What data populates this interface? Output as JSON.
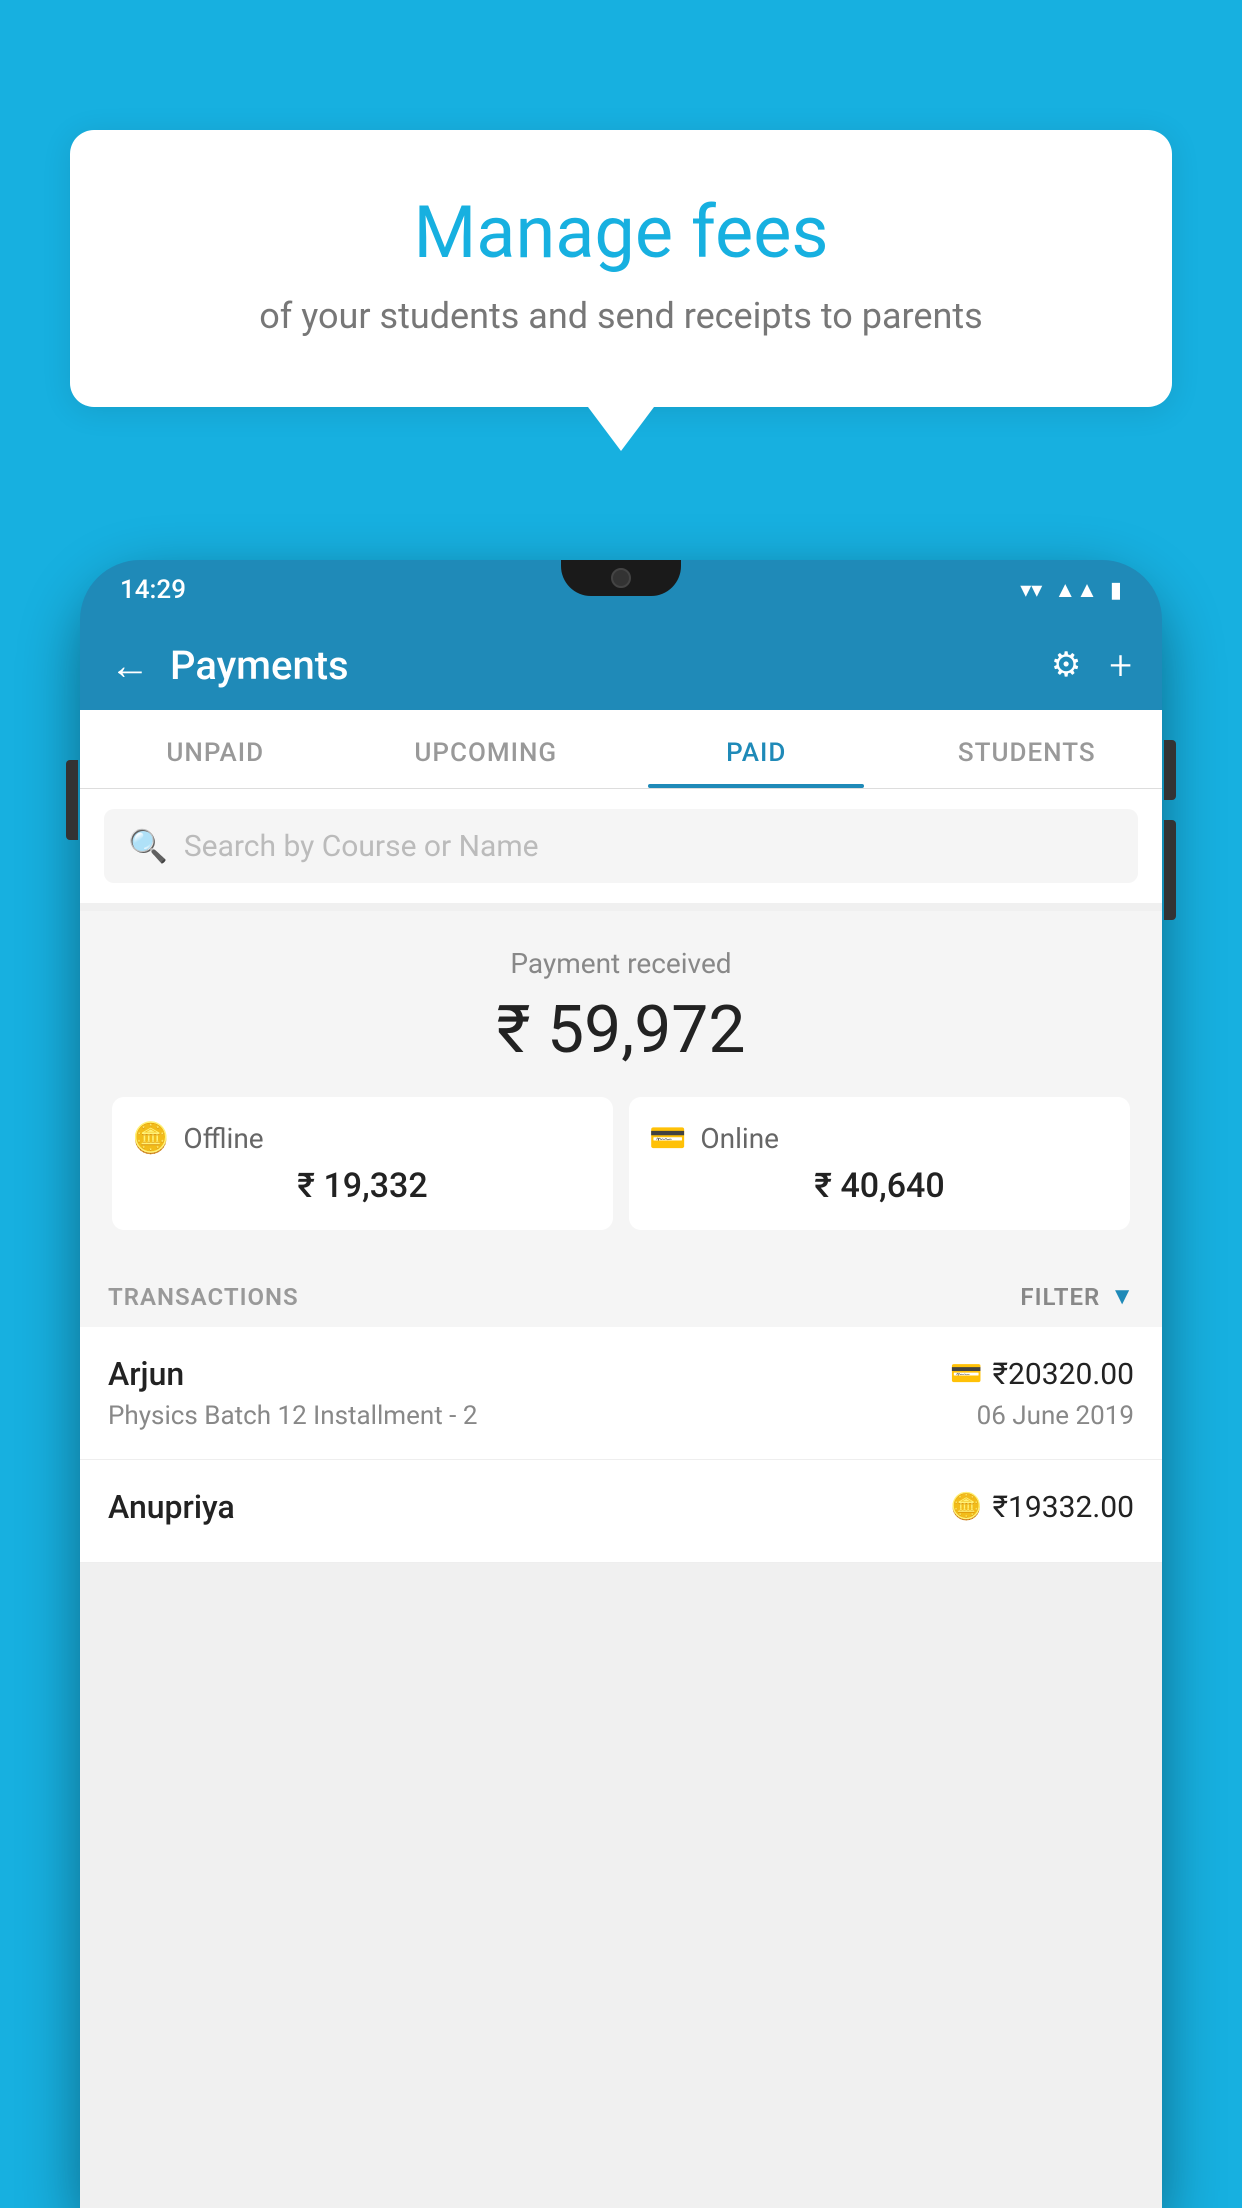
{
  "background_color": "#17B0E0",
  "speech_bubble": {
    "title": "Manage fees",
    "subtitle": "of your students and send receipts to parents"
  },
  "status_bar": {
    "time": "14:29",
    "icons": [
      "wifi",
      "signal",
      "battery"
    ]
  },
  "header": {
    "title": "Payments",
    "back_label": "←",
    "gear_label": "⚙",
    "plus_label": "+"
  },
  "tabs": [
    {
      "label": "UNPAID",
      "active": false
    },
    {
      "label": "UPCOMING",
      "active": false
    },
    {
      "label": "PAID",
      "active": true
    },
    {
      "label": "STUDENTS",
      "active": false
    }
  ],
  "search": {
    "placeholder": "Search by Course or Name"
  },
  "payment_summary": {
    "label": "Payment received",
    "amount": "₹ 59,972",
    "offline": {
      "label": "Offline",
      "amount": "₹ 19,332"
    },
    "online": {
      "label": "Online",
      "amount": "₹ 40,640"
    }
  },
  "transactions_header": {
    "label": "TRANSACTIONS",
    "filter_label": "FILTER"
  },
  "transactions": [
    {
      "name": "Arjun",
      "amount": "₹20320.00",
      "course": "Physics Batch 12 Installment - 2",
      "date": "06 June 2019",
      "payment_type": "online"
    },
    {
      "name": "Anupriya",
      "amount": "₹19332.00",
      "course": "",
      "date": "",
      "payment_type": "offline"
    }
  ]
}
